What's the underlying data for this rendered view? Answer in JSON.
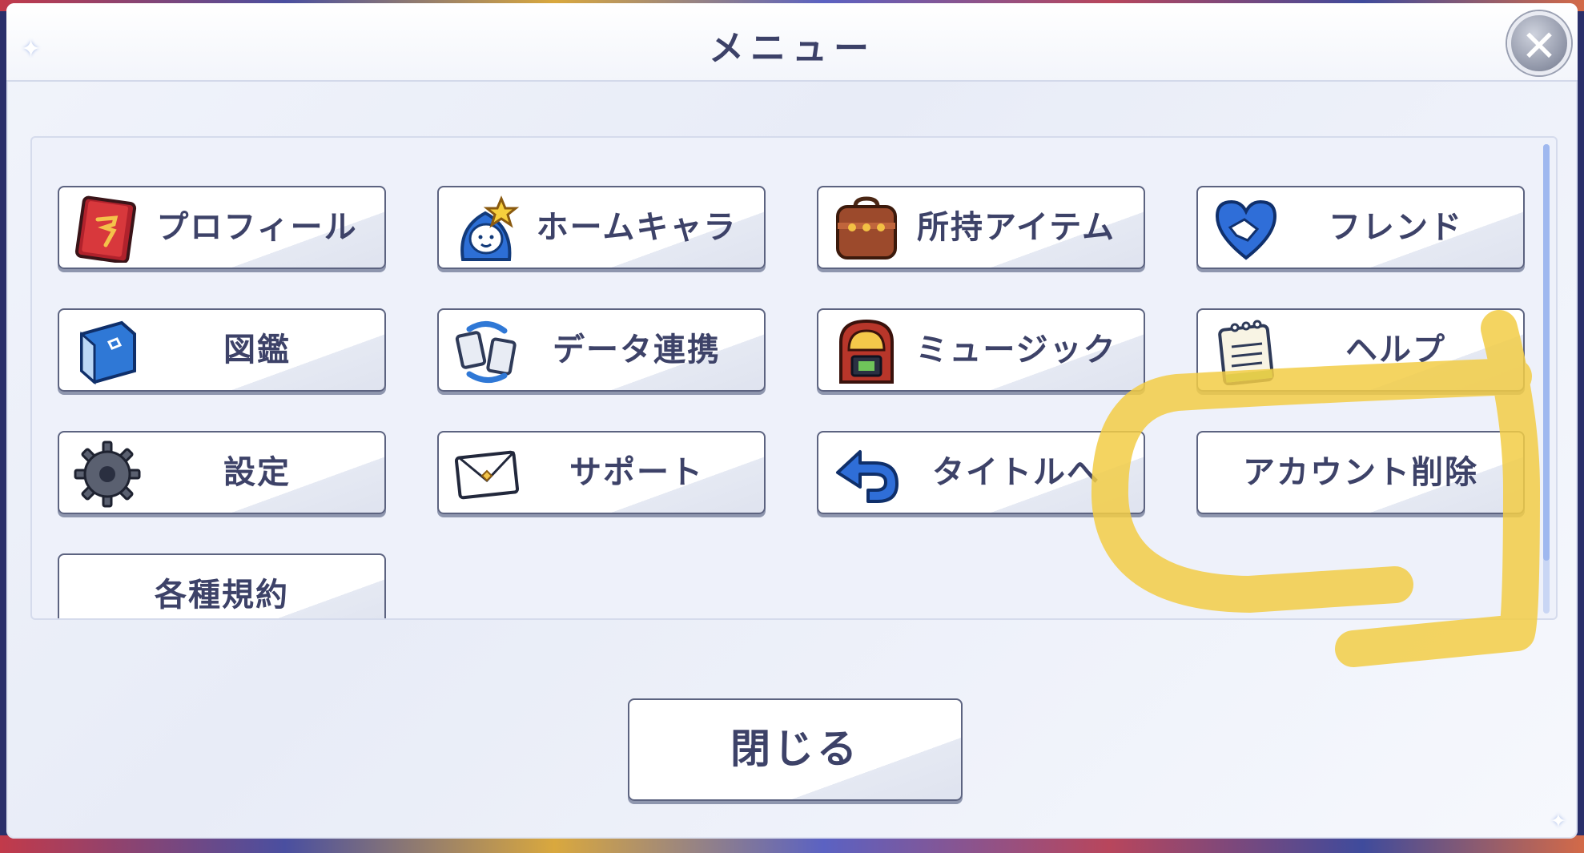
{
  "dialog": {
    "title": "メニュー",
    "close_icon": "close-x-icon",
    "close_button_label": "閉じる"
  },
  "menu": {
    "items": [
      {
        "label": "プロフィール",
        "icon": "profile-book-icon"
      },
      {
        "label": "ホームキャラ",
        "icon": "home-character-icon"
      },
      {
        "label": "所持アイテム",
        "icon": "item-bag-icon"
      },
      {
        "label": "フレンド",
        "icon": "friend-heart-icon"
      },
      {
        "label": "図鑑",
        "icon": "encyclopedia-book-icon"
      },
      {
        "label": "データ連携",
        "icon": "data-link-icon"
      },
      {
        "label": "ミュージック",
        "icon": "jukebox-icon"
      },
      {
        "label": "ヘルプ",
        "icon": "notepad-icon"
      },
      {
        "label": "設定",
        "icon": "gear-icon"
      },
      {
        "label": "サポート",
        "icon": "envelope-icon"
      },
      {
        "label": "タイトルへ",
        "icon": "return-arrow-icon"
      },
      {
        "label": "アカウント削除",
        "icon": ""
      },
      {
        "label": "各種規約",
        "icon": ""
      }
    ]
  },
  "colors": {
    "panel_bg": "#eef1fa",
    "button_border": "#5c6380",
    "label_text": "#3d4268",
    "highlight_stroke": "#f2cd45"
  }
}
